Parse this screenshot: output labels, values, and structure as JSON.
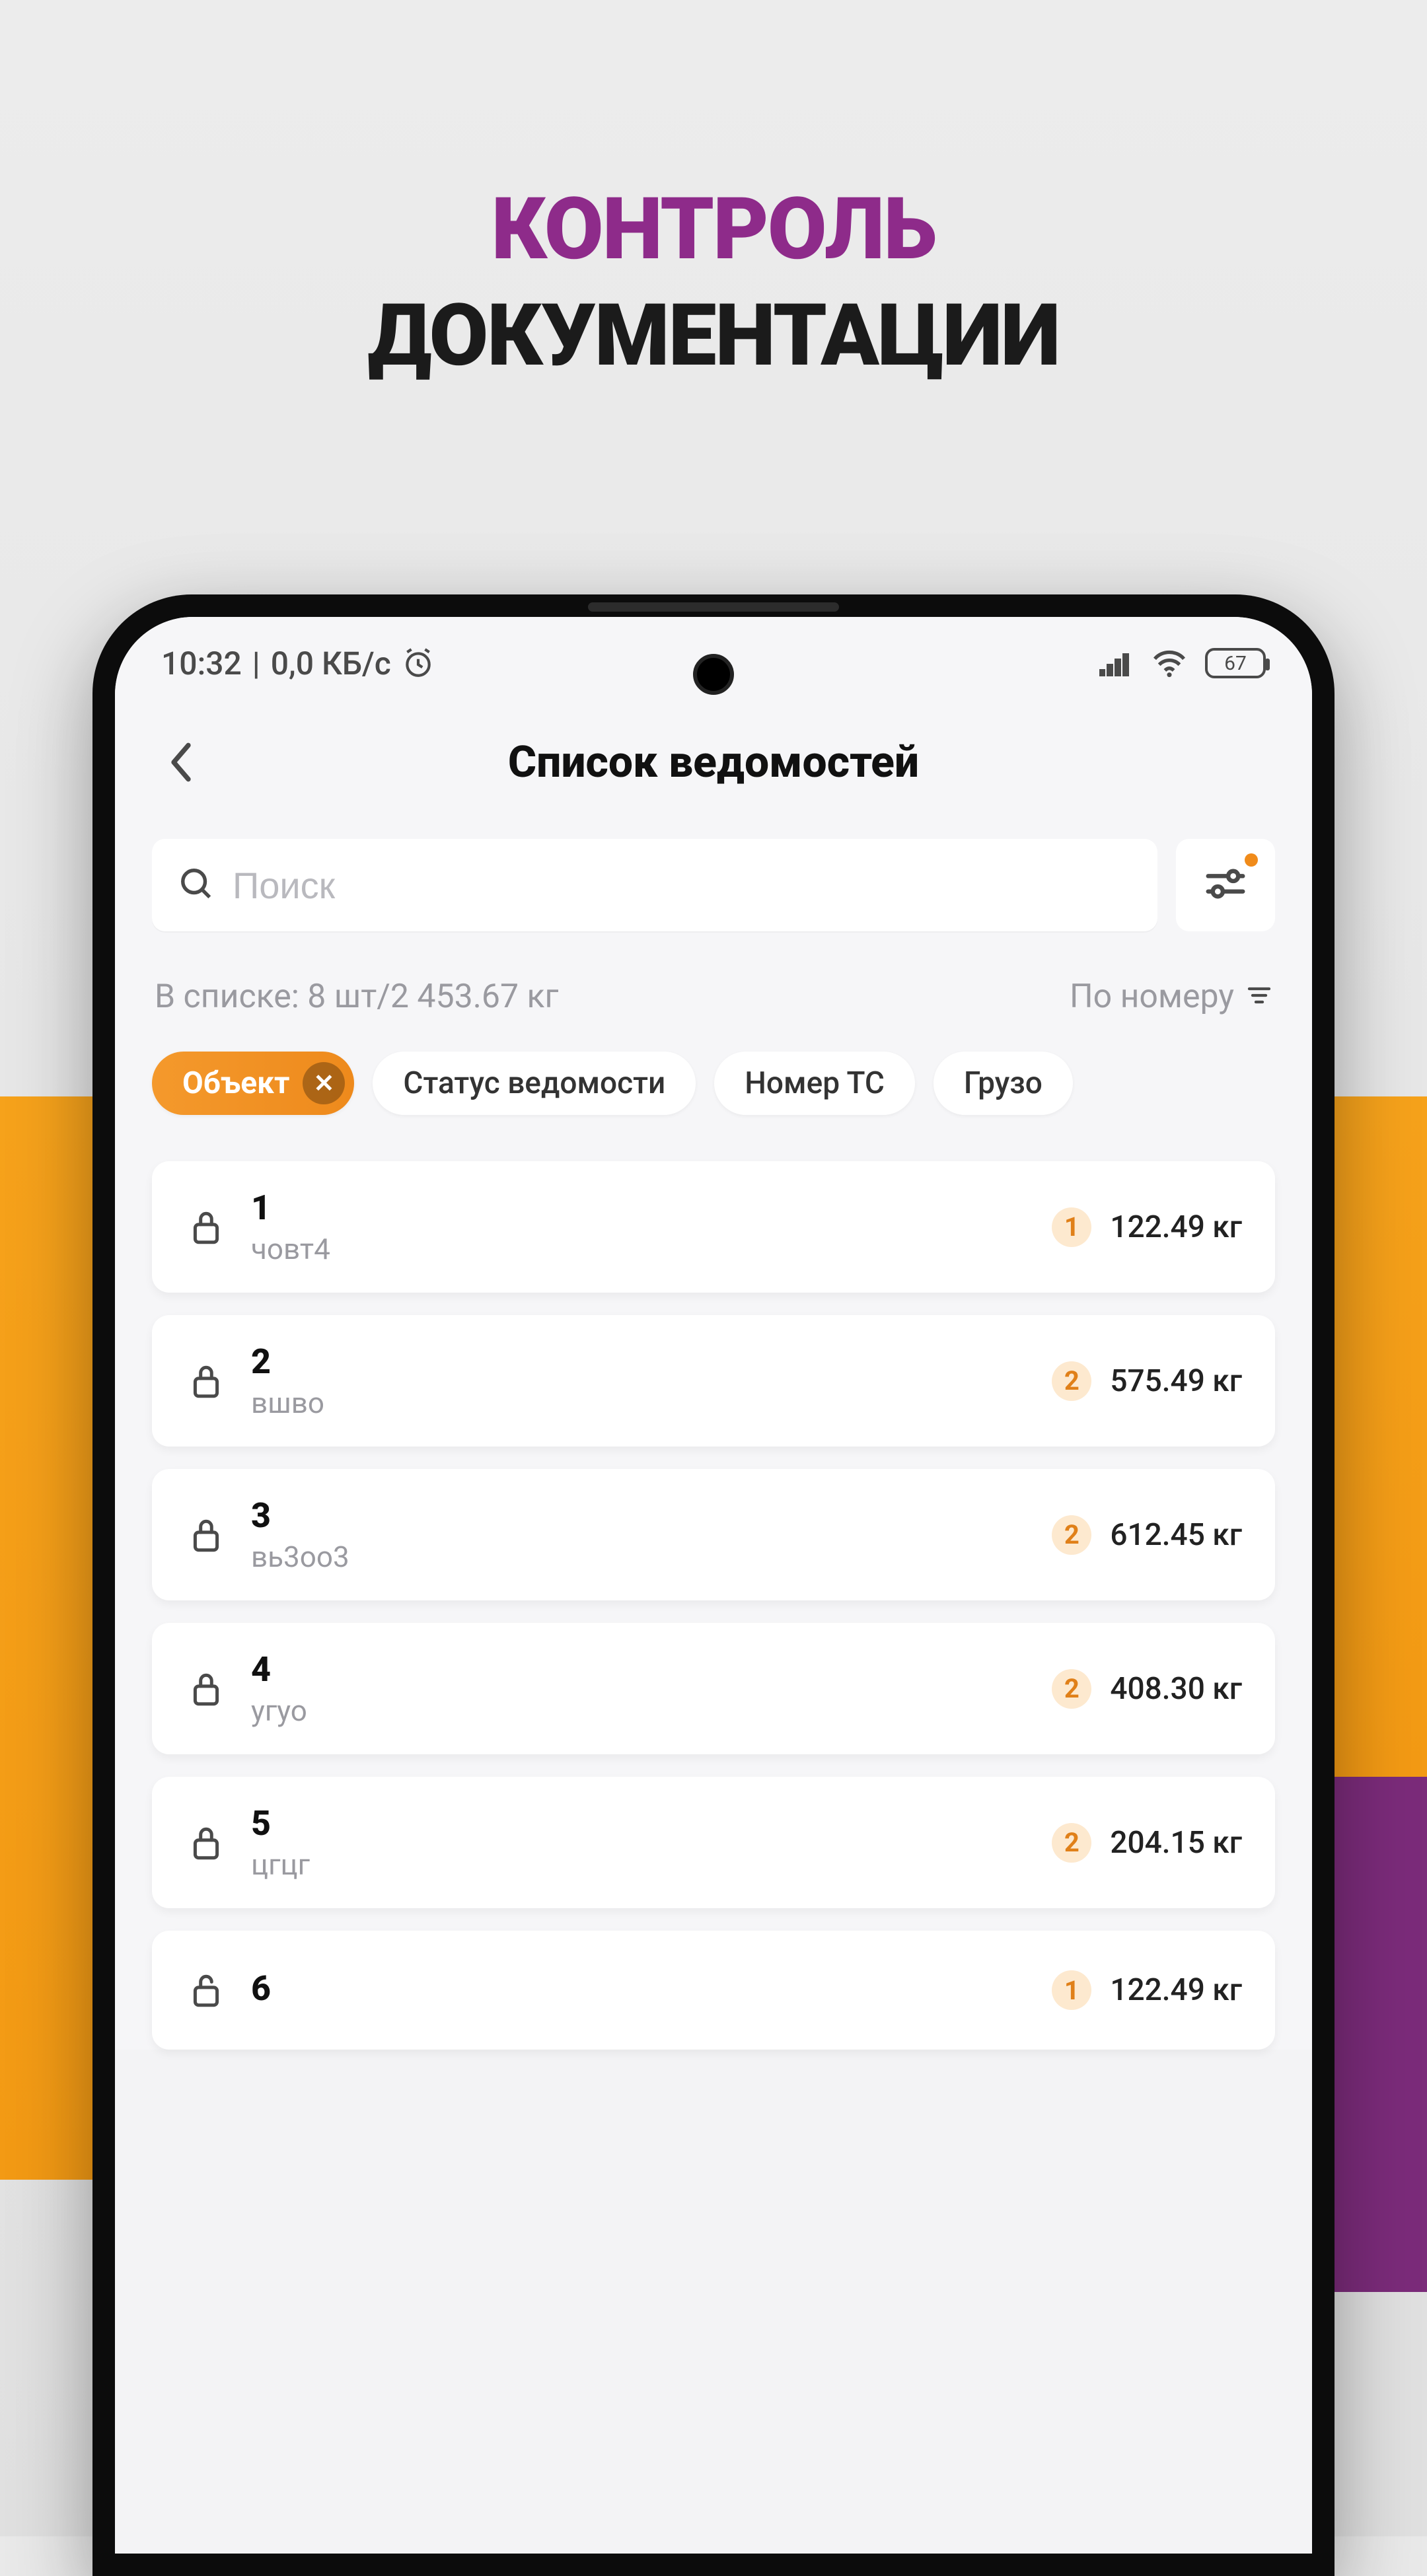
{
  "marketing": {
    "line1": "КОНТРОЛЬ",
    "line2": "ДОКУМЕНТАЦИИ"
  },
  "status": {
    "time": "10:32",
    "net": "0,0 КБ/с",
    "battery": "67"
  },
  "header": {
    "title": "Список ведомостей"
  },
  "search": {
    "placeholder": "Поиск"
  },
  "summary": {
    "text": "В списке: 8 шт/2 453.67 кг",
    "sort_label": "По номеру"
  },
  "chips": [
    {
      "label": "Объект",
      "active": true
    },
    {
      "label": "Статус ведомости",
      "active": false
    },
    {
      "label": "Номер ТС",
      "active": false
    },
    {
      "label": "Грузо",
      "active": false
    }
  ],
  "items": [
    {
      "num": "1",
      "sub": "човт4",
      "count": "1",
      "weight": "122.49 кг",
      "locked": true
    },
    {
      "num": "2",
      "sub": "вшво",
      "count": "2",
      "weight": "575.49 кг",
      "locked": true
    },
    {
      "num": "3",
      "sub": "вь3оо3",
      "count": "2",
      "weight": "612.45 кг",
      "locked": true
    },
    {
      "num": "4",
      "sub": "угуо",
      "count": "2",
      "weight": "408.30 кг",
      "locked": true
    },
    {
      "num": "5",
      "sub": "цгцг",
      "count": "2",
      "weight": "204.15 кг",
      "locked": true
    },
    {
      "num": "6",
      "sub": "",
      "count": "1",
      "weight": "122.49 кг",
      "locked": false
    }
  ]
}
